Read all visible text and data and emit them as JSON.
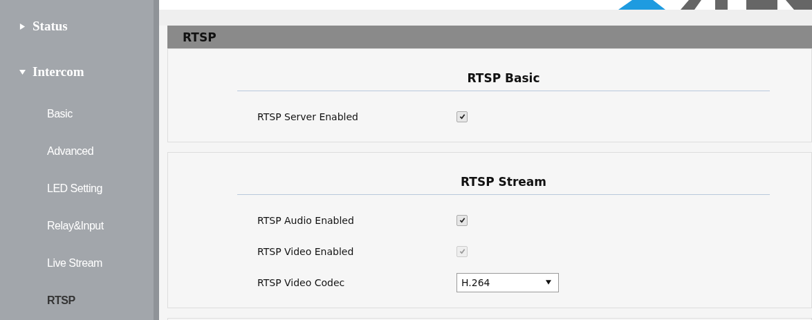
{
  "sidebar": {
    "items": [
      {
        "label": "Status",
        "expanded": false
      },
      {
        "label": "Intercom",
        "expanded": true,
        "children": [
          {
            "label": "Basic",
            "selected": false
          },
          {
            "label": "Advanced",
            "selected": false
          },
          {
            "label": "LED Setting",
            "selected": false
          },
          {
            "label": "Relay&Input",
            "selected": false
          },
          {
            "label": "Live Stream",
            "selected": false
          },
          {
            "label": "RTSP",
            "selected": true
          }
        ]
      }
    ]
  },
  "page": {
    "title": "RTSP",
    "sections": [
      {
        "title": "RTSP Basic",
        "fields": [
          {
            "kind": "checkbox",
            "label": "RTSP Server Enabled",
            "checked": true,
            "disabled": false
          }
        ]
      },
      {
        "title": "RTSP Stream",
        "fields": [
          {
            "kind": "checkbox",
            "label": "RTSP Audio Enabled",
            "checked": true,
            "disabled": false
          },
          {
            "kind": "checkbox",
            "label": "RTSP Video Enabled",
            "checked": true,
            "disabled": true
          },
          {
            "kind": "select",
            "label": "RTSP Video Codec",
            "value": "H.264"
          }
        ]
      }
    ]
  }
}
